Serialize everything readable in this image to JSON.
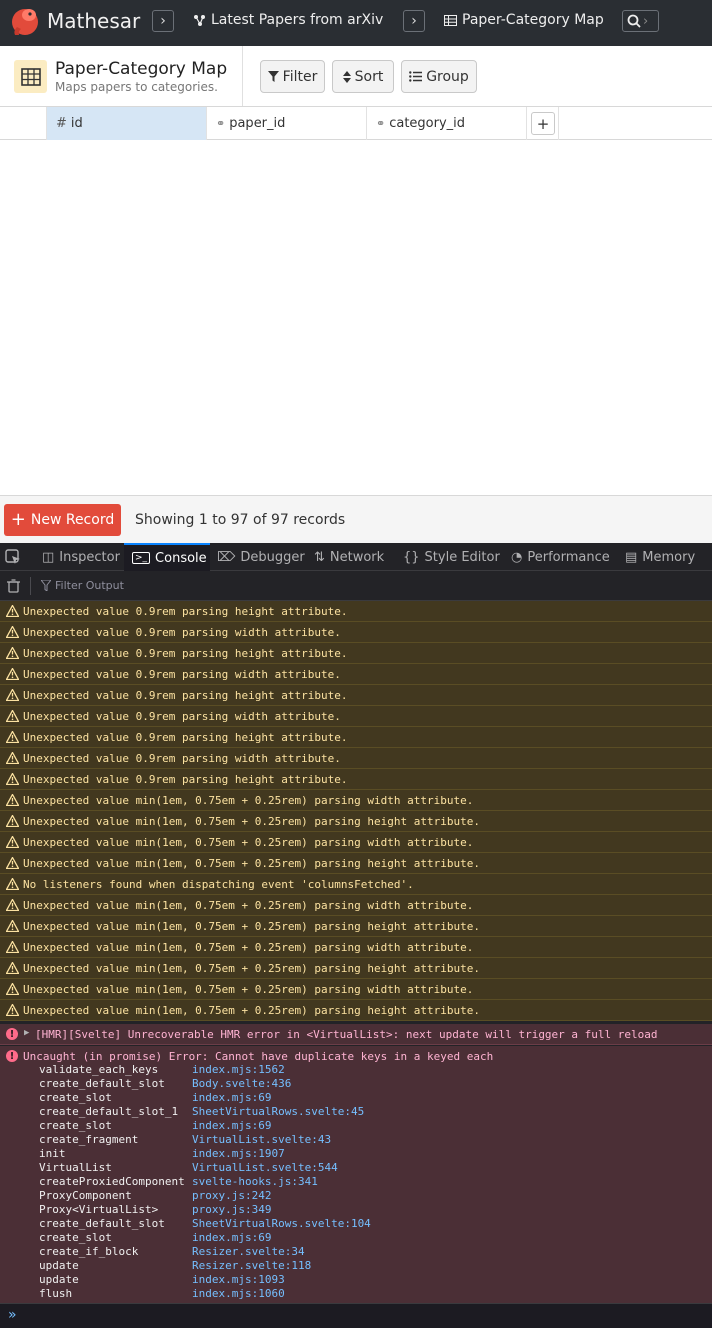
{
  "app": {
    "name": "Mathesar"
  },
  "breadcrumbs": [
    {
      "label": "Latest Papers from arXiv",
      "icon": "schema-icon"
    },
    {
      "label": "Paper-Category Map",
      "icon": "table-icon"
    }
  ],
  "table": {
    "title": "Paper-Category Map",
    "description": "Maps papers to categories."
  },
  "toolbar": {
    "filter": "Filter",
    "sort": "Sort",
    "group": "Group"
  },
  "columns": [
    {
      "name": "id",
      "icon": "hash-icon"
    },
    {
      "name": "paper_id",
      "icon": "link-icon"
    },
    {
      "name": "category_id",
      "icon": "link-icon"
    }
  ],
  "add_column": "+",
  "footer": {
    "new_record": "New Record",
    "showing": "Showing 1 to 97 of 97 records"
  },
  "devtools": {
    "tabs": [
      "Inspector",
      "Console",
      "Debugger",
      "Network",
      "Style Editor",
      "Performance",
      "Memory"
    ],
    "active_tab": "Console",
    "filter_placeholder": "Filter Output",
    "warnings": [
      "Unexpected value 0.9rem parsing height attribute.",
      "Unexpected value 0.9rem parsing width attribute.",
      "Unexpected value 0.9rem parsing height attribute.",
      "Unexpected value 0.9rem parsing width attribute.",
      "Unexpected value 0.9rem parsing height attribute.",
      "Unexpected value 0.9rem parsing width attribute.",
      "Unexpected value 0.9rem parsing height attribute.",
      "Unexpected value 0.9rem parsing width attribute.",
      "Unexpected value 0.9rem parsing height attribute.",
      "Unexpected value min(1em, 0.75em + 0.25rem) parsing width attribute.",
      "Unexpected value min(1em, 0.75em + 0.25rem) parsing height attribute.",
      "Unexpected value min(1em, 0.75em + 0.25rem) parsing width attribute.",
      "Unexpected value min(1em, 0.75em + 0.25rem) parsing height attribute.",
      "No listeners found when dispatching event 'columnsFetched'.",
      "Unexpected value min(1em, 0.75em + 0.25rem) parsing width attribute.",
      "Unexpected value min(1em, 0.75em + 0.25rem) parsing height attribute.",
      "Unexpected value min(1em, 0.75em + 0.25rem) parsing width attribute.",
      "Unexpected value min(1em, 0.75em + 0.25rem) parsing height attribute.",
      "Unexpected value min(1em, 0.75em + 0.25rem) parsing width attribute.",
      "Unexpected value min(1em, 0.75em + 0.25rem) parsing height attribute."
    ],
    "hmr_error": "[HMR][Svelte] Unrecoverable HMR error in <VirtualList>: next update will trigger a full reload",
    "uncaught_error": "Uncaught (in promise) Error: Cannot have duplicate keys in a keyed each",
    "stack": [
      {
        "fn": "validate_each_keys",
        "loc": "index.mjs:1562"
      },
      {
        "fn": "create_default_slot",
        "loc": "Body.svelte:436"
      },
      {
        "fn": "create_slot",
        "loc": "index.mjs:69"
      },
      {
        "fn": "create_default_slot_1",
        "loc": "SheetVirtualRows.svelte:45"
      },
      {
        "fn": "create_slot",
        "loc": "index.mjs:69"
      },
      {
        "fn": "create_fragment",
        "loc": "VirtualList.svelte:43"
      },
      {
        "fn": "init",
        "loc": "index.mjs:1907"
      },
      {
        "fn": "VirtualList",
        "loc": "VirtualList.svelte:544"
      },
      {
        "fn": "createProxiedComponent",
        "loc": "svelte-hooks.js:341"
      },
      {
        "fn": "ProxyComponent",
        "loc": "proxy.js:242"
      },
      {
        "fn": "Proxy<VirtualList>",
        "loc": "proxy.js:349"
      },
      {
        "fn": "create_default_slot",
        "loc": "SheetVirtualRows.svelte:104"
      },
      {
        "fn": "create_slot",
        "loc": "index.mjs:69"
      },
      {
        "fn": "create_if_block",
        "loc": "Resizer.svelte:34"
      },
      {
        "fn": "update",
        "loc": "Resizer.svelte:118"
      },
      {
        "fn": "update",
        "loc": "index.mjs:1093"
      },
      {
        "fn": "flush",
        "loc": "index.mjs:1060"
      }
    ]
  },
  "colors": {
    "topbar": "#2a2e33",
    "accent_red": "#e24b3b",
    "table_icon_bg": "#fbecc2",
    "selected_column": "#d6e6f5",
    "warning_bg": "#42381f",
    "error_bg": "#4b2f36",
    "link_blue": "#75bfff"
  }
}
